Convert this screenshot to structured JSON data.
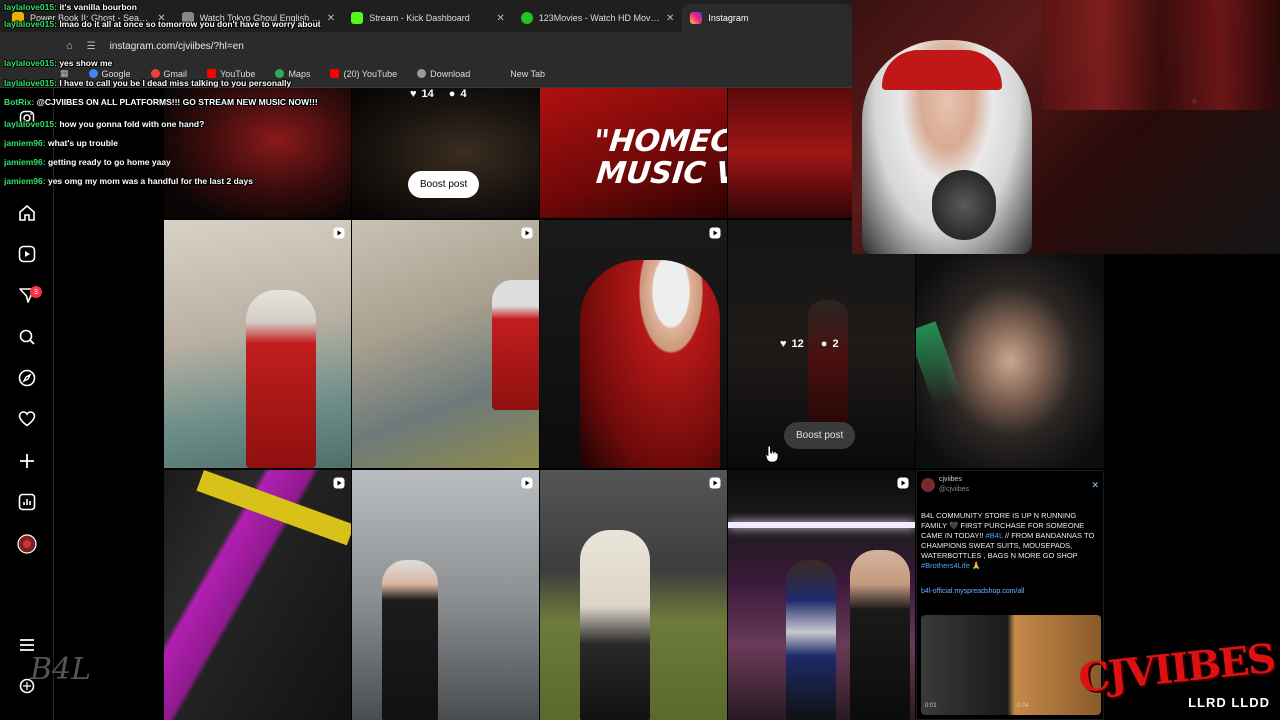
{
  "browser": {
    "tabs": [
      {
        "label": "Power Book II: Ghost - Season",
        "color": "#e8b400",
        "active": false
      },
      {
        "label": "Watch Tokyo Ghoul English Sub",
        "color": "#888888",
        "active": false
      },
      {
        "label": "Stream - Kick Dashboard",
        "color": "#53fc18",
        "active": false
      },
      {
        "label": "123Movies - Watch HD Movies",
        "color": "#21c521",
        "active": false
      },
      {
        "label": "Instagram",
        "color": "#e1306c",
        "active": true
      }
    ],
    "url": "instagram.com/cjviibes/?hl=en",
    "bookmarks": [
      {
        "label": "Google",
        "color": "#4285f4"
      },
      {
        "label": "Gmail",
        "color": "#ea4335"
      },
      {
        "label": "YouTube",
        "color": "#ff0000"
      },
      {
        "label": "Maps",
        "color": "#34a853"
      },
      {
        "label": "(20) YouTube",
        "color": "#ff0000"
      },
      {
        "label": "Download",
        "color": "#999999"
      },
      {
        "label": "New Tab",
        "color": ""
      }
    ]
  },
  "chat": [
    {
      "user": "laylalove015:",
      "msg": "it's vanilla bourbon"
    },
    {
      "user": "laylalove015:",
      "msg": "lmao do it all at once so tomorrow you don't have to worry about"
    },
    {
      "user": "laylalove015:",
      "msg": "yes show me"
    },
    {
      "user": "laylalove015:",
      "msg": "I have to call you be I dead miss talking to you personally"
    },
    {
      "user": "BotRix:",
      "msg": "@CJVIIBES ON ALL PLATFORMS!!! GO STREAM NEW MUSIC NOW!!!"
    },
    {
      "user": "laylalove015:",
      "msg": "how you gonna fold with one hand?"
    },
    {
      "user": "jamiem96:",
      "msg": "what's up trouble"
    },
    {
      "user": "jamiem96:",
      "msg": "getting ready to go home yaay"
    },
    {
      "user": "jamiem96:",
      "msg": "yes omg my mom was a handful for the last 2 days"
    }
  ],
  "sidebar": {
    "notifications_badge": "3",
    "icons": [
      "instagram-icon",
      "home-icon",
      "reels-icon",
      "messages-icon",
      "search-icon",
      "explore-icon",
      "heart-icon",
      "create-icon",
      "dashboard-icon",
      "profile-icon",
      "menu-icon",
      "threads-icon"
    ]
  },
  "grid": {
    "top_post_stats": {
      "likes": "14",
      "comments": "4"
    },
    "hover_post_stats": {
      "likes": "12",
      "comments": "2"
    },
    "boost_label": "Boost post",
    "homecoming_text_1": "\"HOMECO",
    "homecoming_text_2": "MUSIC VIL"
  },
  "promo": {
    "handle": "cjviibes",
    "handle_sub": "@cjviibes",
    "text_1": "B4L COMMUNITY STORE IS UP N RUNNING",
    "text_2": "FAMILY",
    "text_3": "FIRST PURCHASE FOR SOMEONE CAME IN TODAY!!",
    "hashtag_1": "#B4L",
    "text_4": "// FROM BANDANNAS TO CHAMPIONS SWEAT SUITS, MOUSEPADS, WATERBOTTLES , BAGS N MORE GO SHOP",
    "hashtag_2": "#Brothers4Life",
    "link": "b4l-official.myspreadshop.com/all",
    "time_1": "0:01",
    "time_2": "0:04"
  },
  "branding": {
    "logo": "CJVIIBES",
    "sub": "LLRD LLDD",
    "signature": "B4L"
  },
  "colors": {
    "chat_user": "#2fe06a",
    "badge": "#ff3040",
    "brand_red": "#dd1111"
  }
}
